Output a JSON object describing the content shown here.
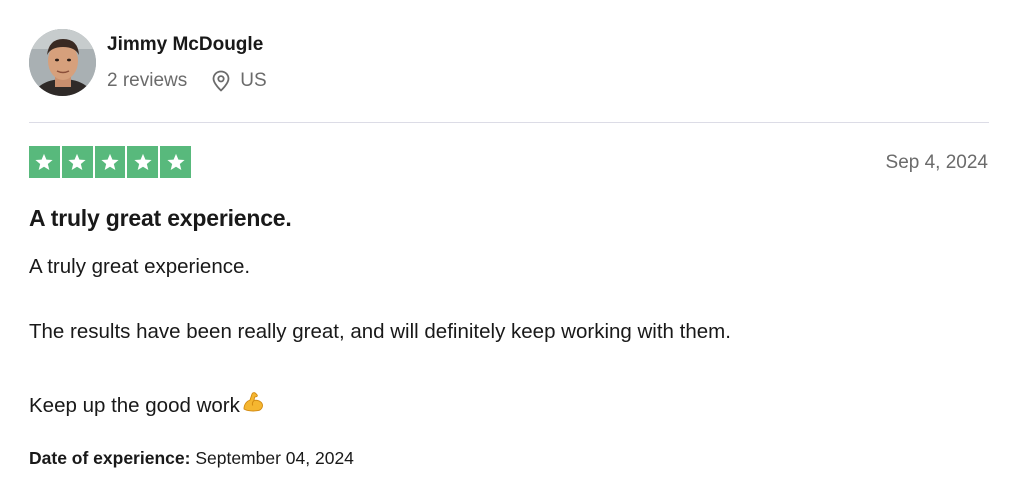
{
  "reviewer": {
    "name": "Jimmy McDougle",
    "review_count": "2 reviews",
    "country": "US",
    "avatar_icon": "user-avatar-photo",
    "location_icon": "location-pin-icon"
  },
  "review": {
    "rating": 5,
    "rating_max": 5,
    "star_color": "#58b97c",
    "date": "Sep 4, 2024",
    "title": "A truly great experience.",
    "body": [
      "A truly great experience.",
      "The results have been really great, and will definitely keep working with them.",
      "Keep up the good work"
    ],
    "body_emoji": "flexed-biceps-icon",
    "experience_label": "Date of experience:",
    "experience_date": "September 04, 2024"
  }
}
